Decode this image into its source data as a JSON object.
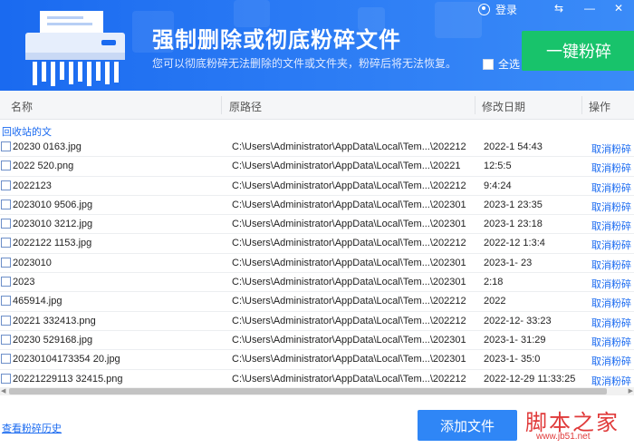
{
  "header": {
    "title": "强制删除或彻底粉碎文件",
    "subtitle": "您可以彻底粉碎无法删除的文件或文件夹，粉碎后将无法恢复。",
    "login_label": "登录",
    "select_all_label": "全选",
    "shred_button_label": "一键粉碎",
    "window_controls": [
      "⇆",
      "—",
      "✕"
    ]
  },
  "table": {
    "columns": [
      "名称",
      "原路径",
      "修改日期",
      "操作"
    ],
    "group_label": "回收站的文",
    "rows": [
      {
        "name": "20230  0163.jpg",
        "path": "C:\\Users\\Administrator\\AppData\\Local\\Tem...\\202212",
        "date": "2022-1  54:43",
        "op": "取消粉碎"
      },
      {
        "name": "2022   520.png",
        "path": "C:\\Users\\Administrator\\AppData\\Local\\Tem...\\20221",
        "date": "12:5:5",
        "op": "取消粉碎"
      },
      {
        "name": "2022123",
        "path": "C:\\Users\\Administrator\\AppData\\Local\\Tem...\\202212",
        "date": "9:4:24",
        "op": "取消粉碎"
      },
      {
        "name": "2023010  9506.jpg",
        "path": "C:\\Users\\Administrator\\AppData\\Local\\Tem...\\202301",
        "date": "2023-1  23:35",
        "op": "取消粉碎"
      },
      {
        "name": "2023010  3212.jpg",
        "path": "C:\\Users\\Administrator\\AppData\\Local\\Tem...\\202301",
        "date": "2023-1  23:18",
        "op": "取消粉碎"
      },
      {
        "name": "2022122  1153.jpg",
        "path": "C:\\Users\\Administrator\\AppData\\Local\\Tem...\\202212",
        "date": "2022-12  1:3:4",
        "op": "取消粉碎"
      },
      {
        "name": "2023010",
        "path": "C:\\Users\\Administrator\\AppData\\Local\\Tem...\\202301",
        "date": "2023-1-  23",
        "op": "取消粉碎"
      },
      {
        "name": "2023",
        "path": "C:\\Users\\Administrator\\AppData\\Local\\Tem...\\202301",
        "date": "2:18",
        "op": "取消粉碎"
      },
      {
        "name": "465914.jpg",
        "path": "C:\\Users\\Administrator\\AppData\\Local\\Tem...\\202212",
        "date": "2022",
        "op": "取消粉碎"
      },
      {
        "name": "20221  332413.png",
        "path": "C:\\Users\\Administrator\\AppData\\Local\\Tem...\\202212",
        "date": "2022-12-  33:23",
        "op": "取消粉碎"
      },
      {
        "name": "20230  529168.jpg",
        "path": "C:\\Users\\Administrator\\AppData\\Local\\Tem...\\202301",
        "date": "2023-1-  31:29",
        "op": "取消粉碎"
      },
      {
        "name": "20230104173354 20.jpg",
        "path": "C:\\Users\\Administrator\\AppData\\Local\\Tem...\\202301",
        "date": "2023-1-  35:0",
        "op": "取消粉碎"
      },
      {
        "name": "20221229113 32415.png",
        "path": "C:\\Users\\Administrator\\AppData\\Local\\Tem...\\202212",
        "date": "2022-12-29 11:33:25",
        "op": "取消粉碎"
      }
    ]
  },
  "footer": {
    "history_link": "查看粉碎历史",
    "add_button_label": "添加文件",
    "watermark_cn": "脚本之家",
    "watermark_url": "www.jb51.net"
  }
}
